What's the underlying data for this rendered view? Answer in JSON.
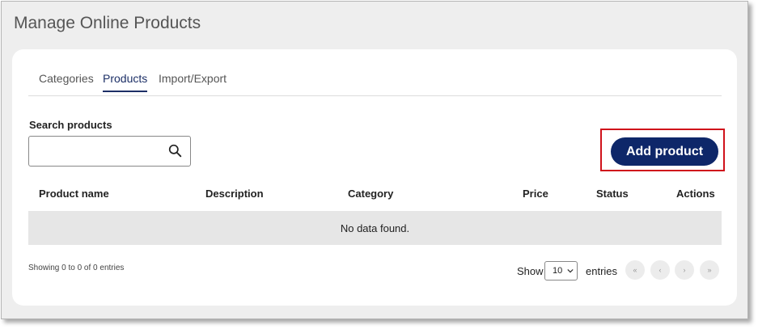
{
  "page": {
    "title": "Manage Online Products"
  },
  "tabs": [
    {
      "label": "Categories",
      "active": false
    },
    {
      "label": "Products",
      "active": true
    },
    {
      "label": "Import/Export",
      "active": false
    }
  ],
  "search": {
    "label": "Search products",
    "value": "",
    "placeholder": ""
  },
  "actions": {
    "add_product": "Add product"
  },
  "table": {
    "columns": [
      "Product name",
      "Description",
      "Category",
      "Price",
      "Status",
      "Actions"
    ],
    "empty_text": "No data found."
  },
  "footer": {
    "info": "Showing 0 to 0 of 0 entries",
    "show_label": "Show",
    "page_size": "10",
    "entries_label": "entries",
    "pagination": [
      "«",
      "‹",
      "›",
      "»"
    ]
  },
  "colors": {
    "primary": "#0e2769",
    "active_tab": "#1c2f66",
    "highlight": "#d0121b",
    "background": "#eeeeee"
  }
}
